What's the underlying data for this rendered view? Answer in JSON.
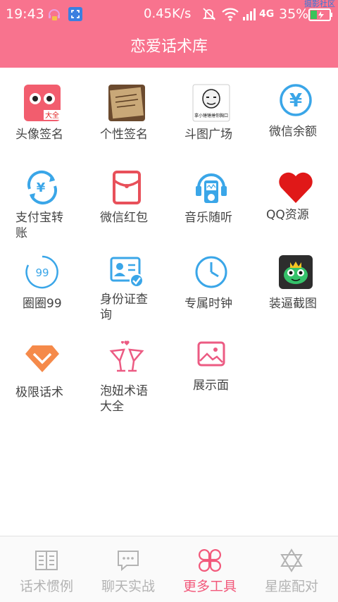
{
  "status_bar": {
    "time": "19:43",
    "speed": "0.45K/s",
    "network": "4G",
    "battery": "35%",
    "watermark": "摄影社区"
  },
  "header": {
    "title": "恋爱话术库"
  },
  "colors": {
    "accent": "#f8738e",
    "active_tab": "#f2597b",
    "inactive_tab": "#b3b3b3"
  },
  "tools": [
    {
      "label": "头像签名",
      "icon": "avatar-icon",
      "badge": "大全"
    },
    {
      "label": "个性签名",
      "icon": "signature-photo-icon"
    },
    {
      "label": "斗图广场",
      "icon": "meme-icon",
      "caption": "拿小锤锤捶你胸口"
    },
    {
      "label": "微信余额",
      "icon": "yen-icon",
      "symbol": "¥"
    },
    {
      "label": "支付宝转账",
      "icon": "alipay-transfer-icon",
      "symbol": "¥"
    },
    {
      "label": "微信红包",
      "icon": "red-packet-icon"
    },
    {
      "label": "音乐随听",
      "icon": "music-player-icon"
    },
    {
      "label": "QQ资源",
      "icon": "heart-icon"
    },
    {
      "label": "圈圈99",
      "icon": "circle-99-icon",
      "number": "99"
    },
    {
      "label": "身份证查询",
      "icon": "id-card-icon"
    },
    {
      "label": "专属时钟",
      "icon": "clock-icon"
    },
    {
      "label": "装逼截图",
      "icon": "frog-king-icon"
    },
    {
      "label": "极限话术",
      "icon": "diamond-icon"
    },
    {
      "label": "泡妞术语大全",
      "icon": "cocktail-icon"
    },
    {
      "label": "展示面",
      "icon": "picture-icon"
    }
  ],
  "bottom_nav": [
    {
      "label": "话术惯例",
      "icon": "book-icon",
      "active": false
    },
    {
      "label": "聊天实战",
      "icon": "chat-bubble-icon",
      "active": false
    },
    {
      "label": "更多工具",
      "icon": "four-petal-icon",
      "active": true
    },
    {
      "label": "星座配对",
      "icon": "star-of-david-icon",
      "active": false
    }
  ]
}
